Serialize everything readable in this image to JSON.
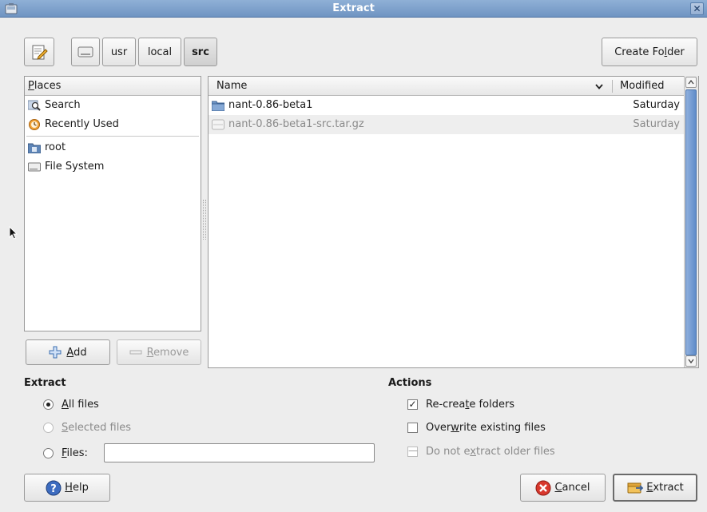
{
  "window": {
    "title": "Extract",
    "close_glyph": "✕"
  },
  "toolbar": {
    "path_buttons": [
      "usr",
      "local",
      "src"
    ],
    "create_folder": {
      "before": "Create Fo",
      "mn": "l",
      "after": "der"
    }
  },
  "places": {
    "header": {
      "mn": "P",
      "after": "laces"
    },
    "items": [
      {
        "label": "Search",
        "icon": "magnifier-icon"
      },
      {
        "label": "Recently Used",
        "icon": "clock-icon"
      },
      {
        "label": "root",
        "icon": "home-folder-icon"
      },
      {
        "label": "File System",
        "icon": "drive-icon"
      }
    ],
    "add": {
      "mn": "A",
      "after": "dd"
    },
    "remove": {
      "mn": "R",
      "after": "emove"
    }
  },
  "files": {
    "col_name": "Name",
    "col_modified": "Modified",
    "rows": [
      {
        "name": "nant-0.86-beta1",
        "modified": "Saturday",
        "icon": "folder-icon"
      },
      {
        "name": "nant-0.86-beta1-src.tar.gz",
        "modified": "Saturday",
        "icon": "archive-icon"
      }
    ]
  },
  "extract": {
    "title": "Extract",
    "all_files": {
      "mn": "A",
      "after": "ll files"
    },
    "selected_files": {
      "mn": "S",
      "after": "elected files"
    },
    "files": {
      "mn": "F",
      "after": "iles:"
    },
    "files_value": ""
  },
  "actions": {
    "title": "Actions",
    "recreate": {
      "before": "Re-crea",
      "mn": "t",
      "after": "e folders"
    },
    "overwrite": {
      "before": "Over",
      "mn": "w",
      "after": "rite existing files"
    },
    "older": {
      "before": "Do not e",
      "mn": "x",
      "after": "tract older files"
    }
  },
  "footer": {
    "help": {
      "mn": "H",
      "after": "elp"
    },
    "cancel": {
      "mn": "C",
      "after": "ancel"
    },
    "extract": {
      "mn": "E",
      "after": "xtract"
    }
  },
  "colors": {
    "title_bar": "#7b9dc9",
    "selection_blue": "#5f8cc9",
    "cancel_red": "#d8382d"
  }
}
